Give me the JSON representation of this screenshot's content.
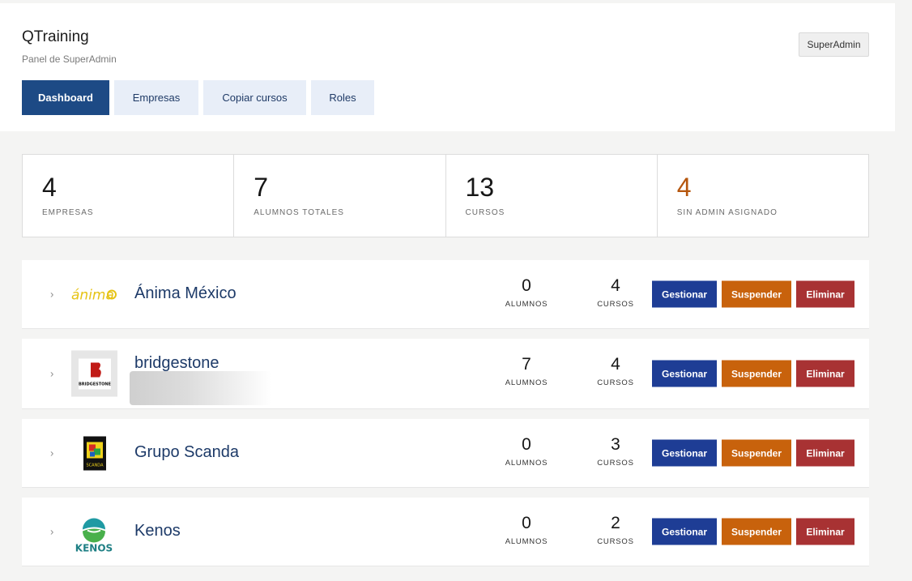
{
  "header": {
    "title": "QTraining",
    "subtitle": "Panel de SuperAdmin",
    "role_badge": "SuperAdmin"
  },
  "tabs": [
    {
      "label": "Dashboard",
      "active": true
    },
    {
      "label": "Empresas",
      "active": false
    },
    {
      "label": "Copiar cursos",
      "active": false
    },
    {
      "label": "Roles",
      "active": false
    }
  ],
  "stats": [
    {
      "value": "4",
      "label": "EMPRESAS"
    },
    {
      "value": "7",
      "label": "ALUMNOS TOTALES"
    },
    {
      "value": "13",
      "label": "CURSOS"
    },
    {
      "value": "4",
      "label": "SIN ADMIN ASIGNADO"
    }
  ],
  "companies": [
    {
      "name": "Ánima México",
      "logo_icon": "anima-logo",
      "logo_text": "ánima",
      "alumnos": "0",
      "cursos": "4"
    },
    {
      "name": "bridgestone",
      "logo_icon": "bridgestone-logo",
      "logo_text": "BRIDGESTONE",
      "alumnos": "7",
      "cursos": "4"
    },
    {
      "name": "Grupo Scanda",
      "logo_icon": "scanda-logo",
      "logo_text": "SCANDA",
      "alumnos": "0",
      "cursos": "3"
    },
    {
      "name": "Kenos",
      "logo_icon": "kenos-logo",
      "logo_text": "KENOS",
      "alumnos": "0",
      "cursos": "2"
    }
  ],
  "labels": {
    "alumnos": "ALUMNOS",
    "cursos": "CURSOS",
    "manage": "Gestionar",
    "suspend": "Suspender",
    "delete": "Eliminar",
    "chevron": "›"
  },
  "colors": {
    "primary": "#1d4a85",
    "manage": "#1e3d95",
    "suspend": "#c8620c",
    "delete": "#a83233",
    "warning_stat": "#b5560d"
  }
}
